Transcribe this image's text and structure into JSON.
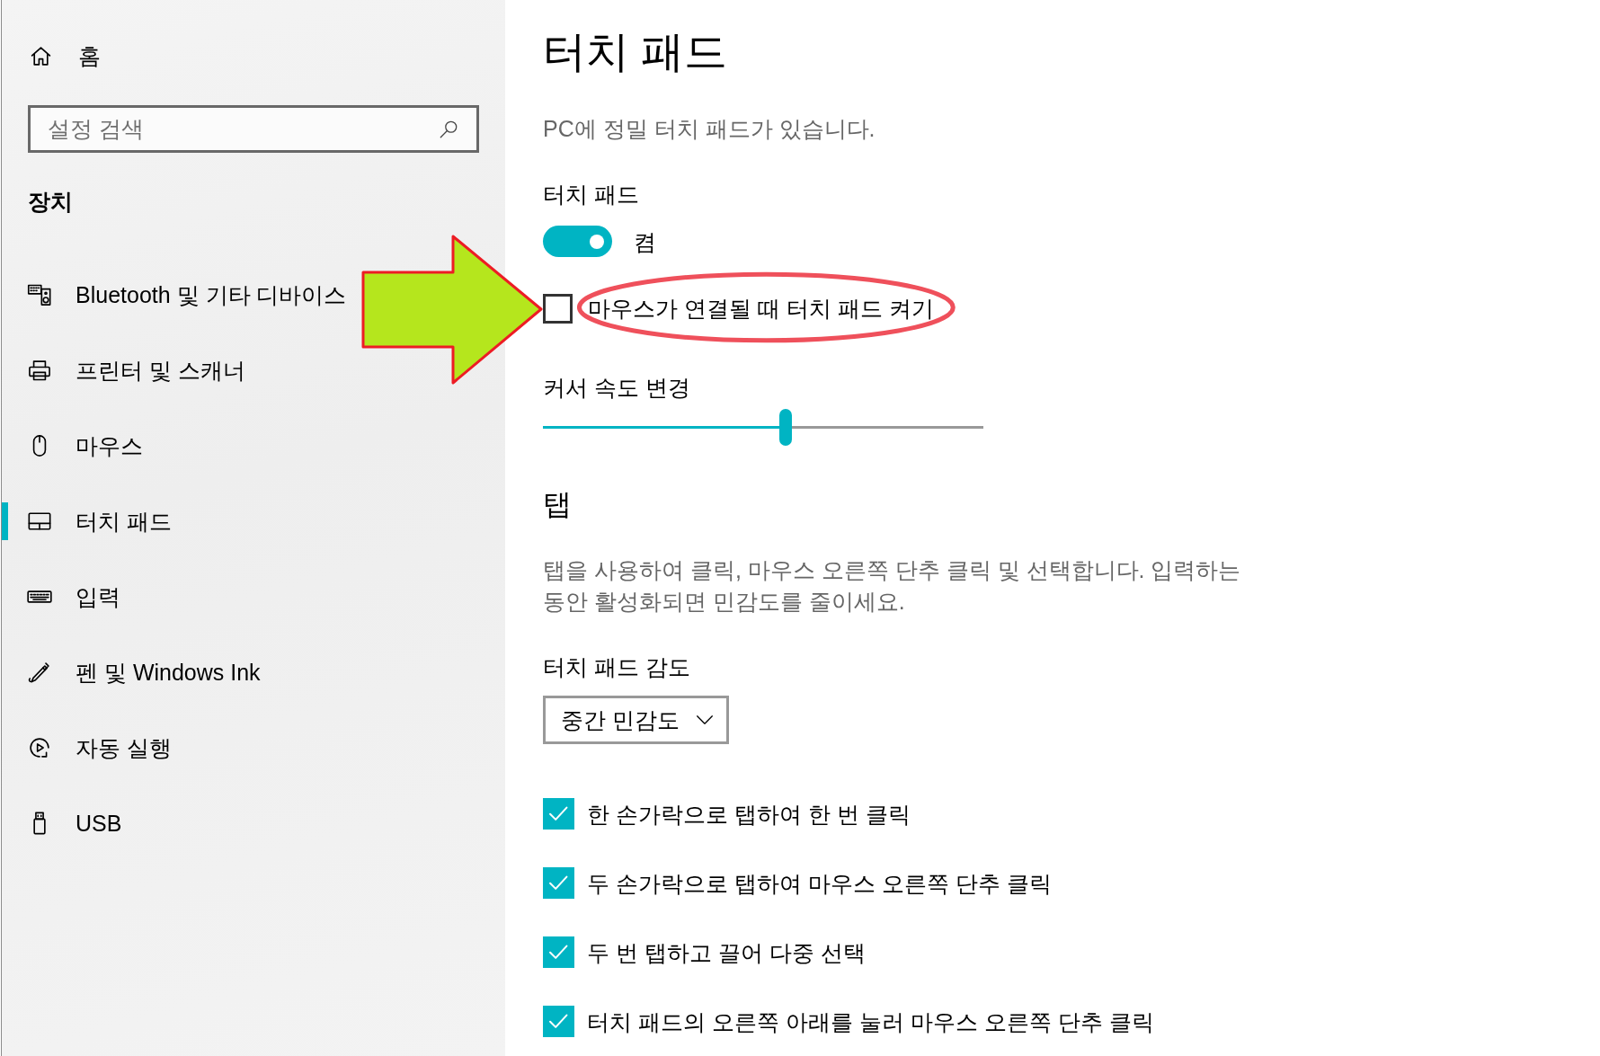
{
  "sidebar": {
    "home": {
      "label": "홈"
    },
    "search": {
      "placeholder": "설정 검색"
    },
    "section_title": "장치",
    "items": [
      {
        "label": "Bluetooth 및 기타 디바이스",
        "selected": false
      },
      {
        "label": "프린터 및 스캐너",
        "selected": false
      },
      {
        "label": "마우스",
        "selected": false
      },
      {
        "label": "터치 패드",
        "selected": true
      },
      {
        "label": "입력",
        "selected": false
      },
      {
        "label": "펜 및 Windows Ink",
        "selected": false
      },
      {
        "label": "자동 실행",
        "selected": false
      },
      {
        "label": "USB",
        "selected": false
      }
    ]
  },
  "page": {
    "title": "터치 패드",
    "subtitle": "PC에 정밀 터치 패드가 있습니다."
  },
  "touchpad": {
    "label": "터치 패드",
    "toggle": {
      "on": true,
      "state_label": "켬"
    },
    "mouse_option": {
      "label": "마우스가 연결될 때 터치 패드 켜기",
      "checked": false,
      "circled": true,
      "arrow": true
    }
  },
  "cursor_speed": {
    "label": "커서 속도 변경",
    "level": 0.55
  },
  "taps": {
    "heading": "탭",
    "description": "탭을 사용하여 클릭, 마우스 오른쪽 단추 클릭 및 선택합니다. 입력하는 동안 활성화되면 민감도를 줄이세요.",
    "sensitivity": {
      "label": "터치 패드 감도",
      "value": "중간 민감도"
    },
    "options": [
      {
        "label": "한 손가락으로 탭하여 한 번 클릭",
        "checked": true
      },
      {
        "label": "두 손가락으로 탭하여 마우스 오른쪽 단추 클릭",
        "checked": true
      },
      {
        "label": "두 번 탭하고 끌어 다중 선택",
        "checked": true
      },
      {
        "label": "터치 패드의 오른쪽 아래를 눌러 마우스 오른쪽 단추 클릭",
        "checked": true
      }
    ]
  }
}
